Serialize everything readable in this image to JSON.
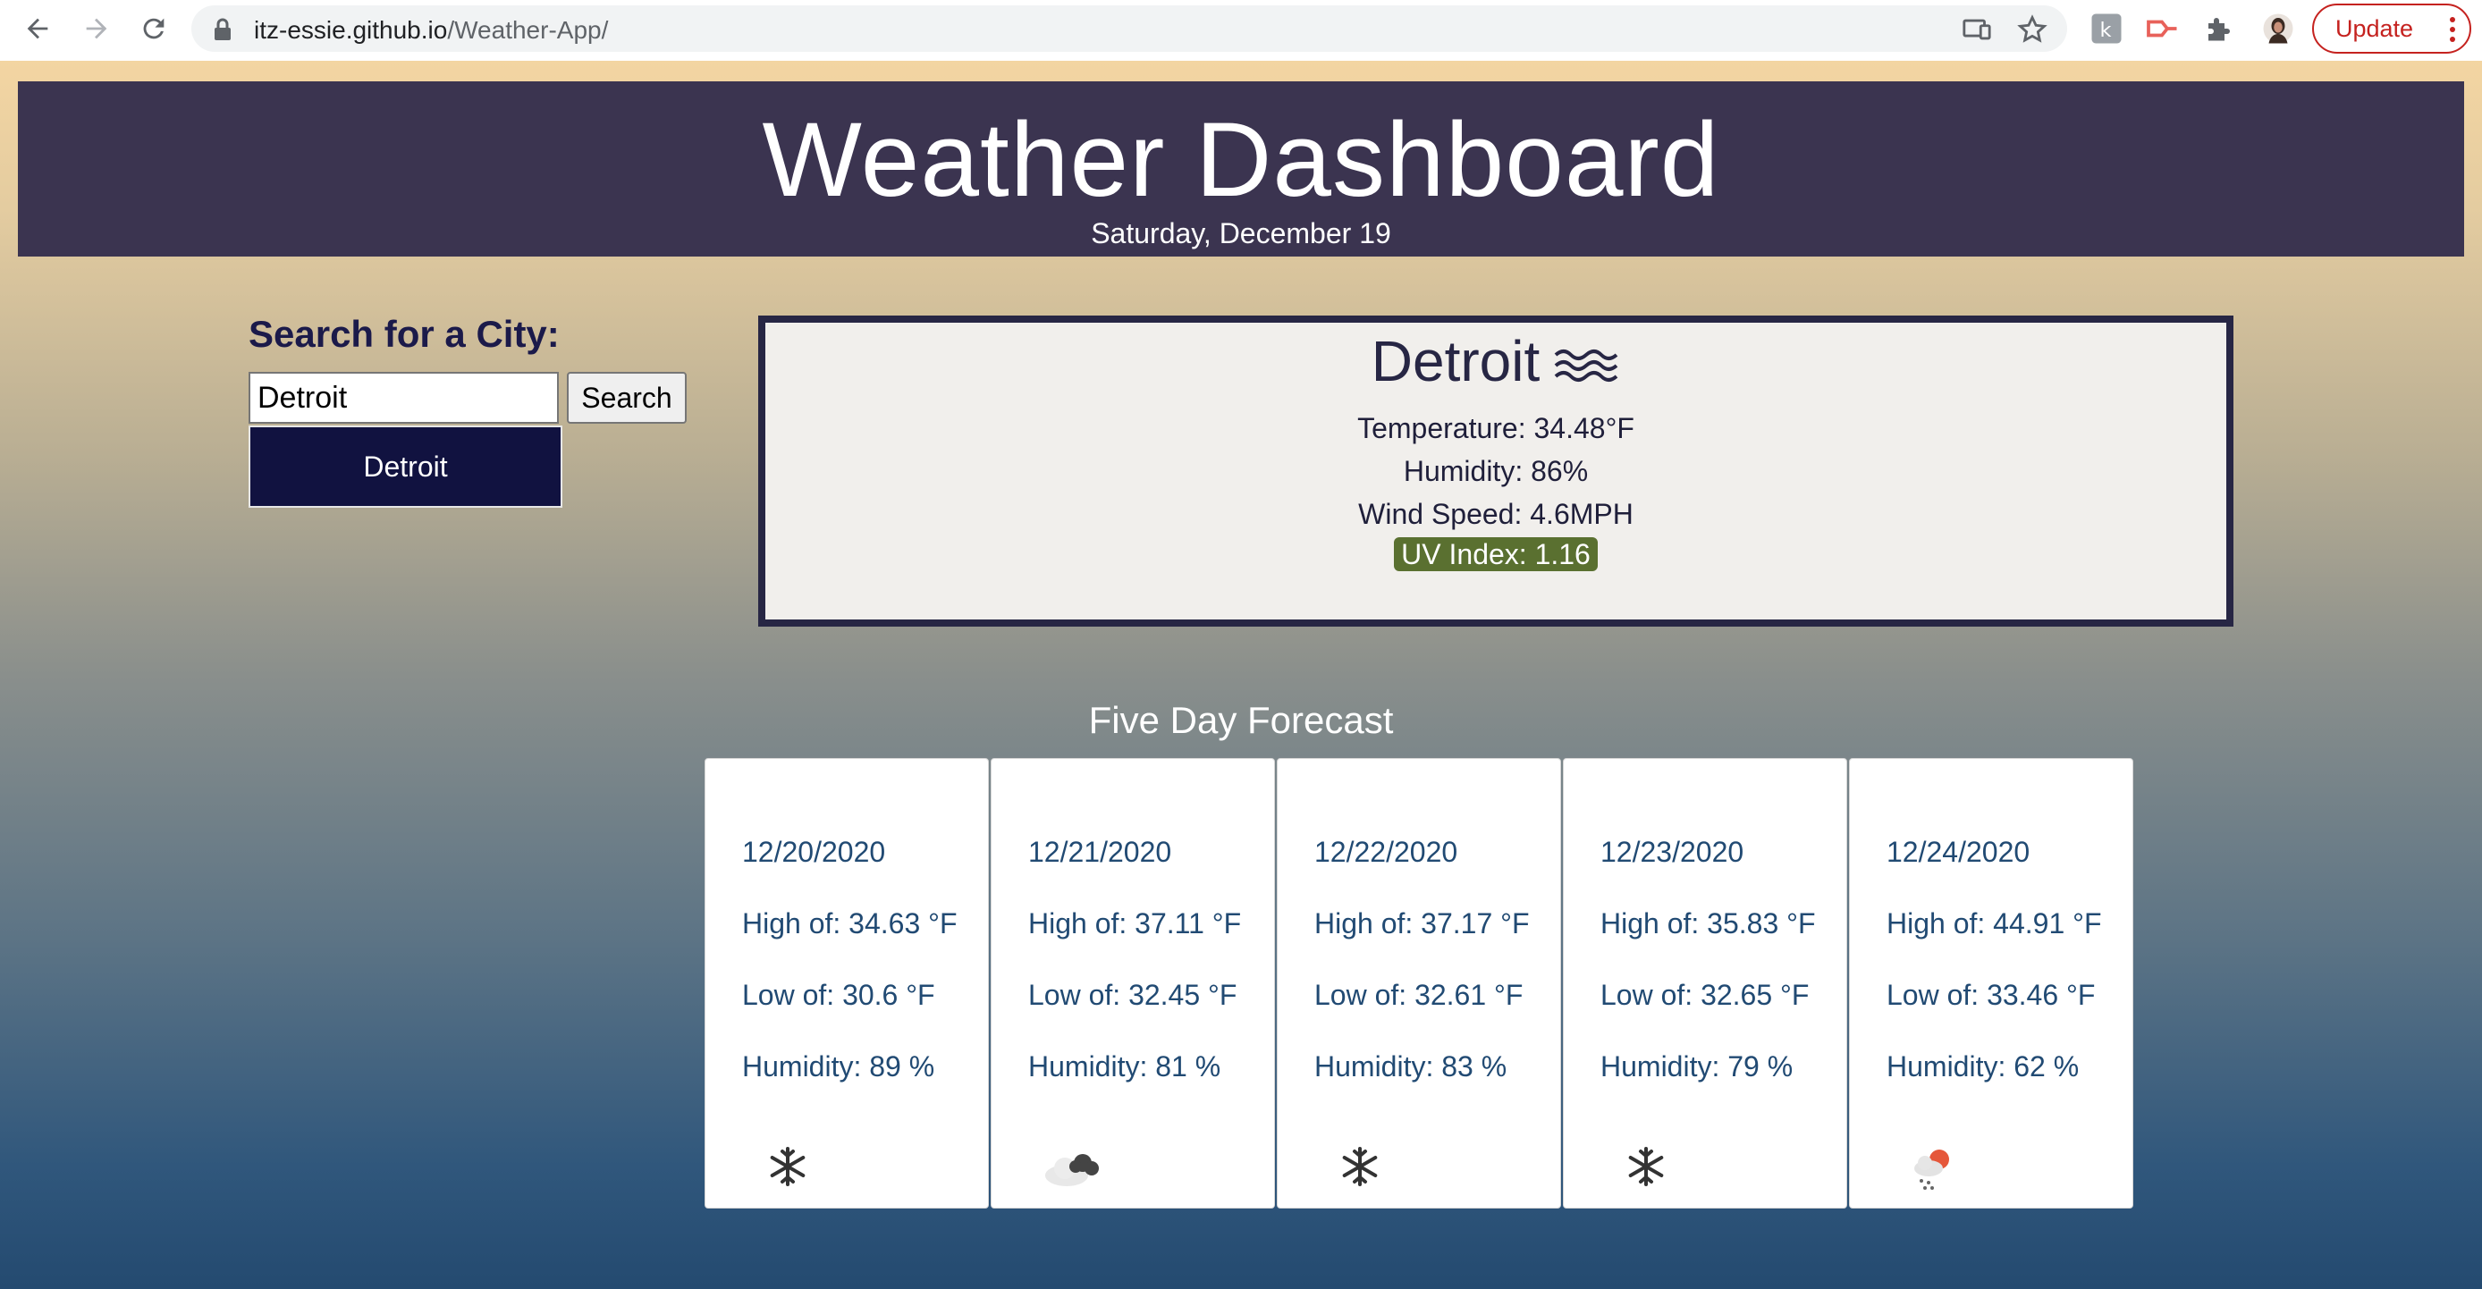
{
  "browser": {
    "url_host": "itz-essie.github.io",
    "url_path": "/Weather-App/",
    "update_label": "Update"
  },
  "header": {
    "title": "Weather Dashboard",
    "date": "Saturday, December 19"
  },
  "search": {
    "label": "Search for a City:",
    "value": "Detroit",
    "button_label": "Search",
    "history": [
      "Detroit"
    ]
  },
  "current": {
    "city": "Detroit",
    "icon": "wind-icon",
    "temperature": "Temperature: 34.48°F",
    "humidity": "Humidity: 86%",
    "wind": "Wind Speed: 4.6MPH",
    "uv": "UV Index: 1.16",
    "uv_color": "#5a7030"
  },
  "forecast": {
    "title": "Five Day Forecast",
    "days": [
      {
        "date": "12/20/2020",
        "high": "High of: 34.63 °F",
        "low": "Low of: 30.6 °F",
        "humidity": "Humidity: 89 %",
        "icon": "snowflake-icon"
      },
      {
        "date": "12/21/2020",
        "high": "High of: 37.11 °F",
        "low": "Low of: 32.45 °F",
        "humidity": "Humidity: 81 %",
        "icon": "cloudy-icon"
      },
      {
        "date": "12/22/2020",
        "high": "High of: 37.17 °F",
        "low": "Low of: 32.61 °F",
        "humidity": "Humidity: 83 %",
        "icon": "snowflake-icon"
      },
      {
        "date": "12/23/2020",
        "high": "High of: 35.83 °F",
        "low": "Low of: 32.65 °F",
        "humidity": "Humidity: 79 %",
        "icon": "snowflake-icon"
      },
      {
        "date": "12/24/2020",
        "high": "High of: 44.91 °F",
        "low": "Low of: 33.46 °F",
        "humidity": "Humidity: 62 %",
        "icon": "snow-sun-icon"
      }
    ]
  },
  "colors": {
    "header_bg": "#3b3450",
    "history_bg": "#111240",
    "forecast_text": "#214a73"
  }
}
